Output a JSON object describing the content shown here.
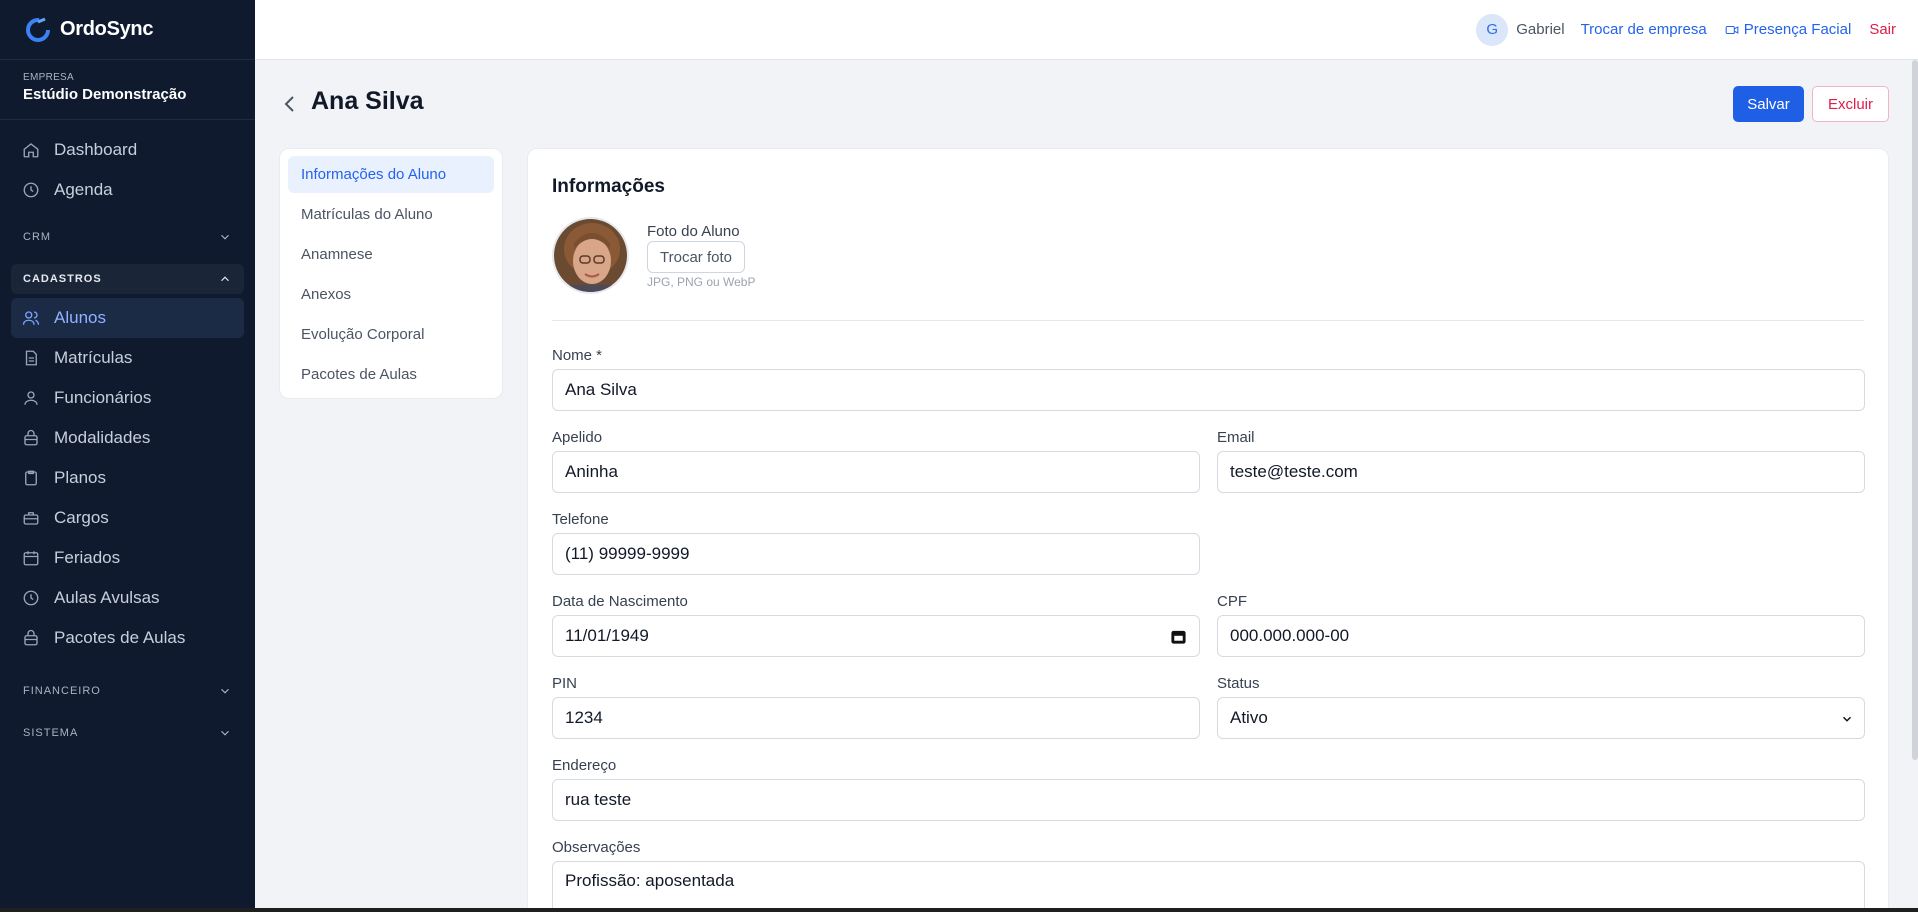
{
  "brand": {
    "name": "OrdoSync"
  },
  "company": {
    "label": "EMPRESA",
    "name": "Estúdio Demonstração"
  },
  "sidebar": {
    "top_items": [
      {
        "label": "Dashboard",
        "icon": "home-icon"
      },
      {
        "label": "Agenda",
        "icon": "clock-icon"
      }
    ],
    "sections": {
      "crm": "CRM",
      "cadastros": "CADASTROS",
      "financeiro": "FINANCEIRO",
      "sistema": "SISTEMA"
    },
    "cadastros_items": [
      {
        "label": "Alunos",
        "icon": "users-icon",
        "active": true
      },
      {
        "label": "Matrículas",
        "icon": "document-icon"
      },
      {
        "label": "Funcionários",
        "icon": "user-icon"
      },
      {
        "label": "Modalidades",
        "icon": "bag-icon"
      },
      {
        "label": "Planos",
        "icon": "clipboard-icon"
      },
      {
        "label": "Cargos",
        "icon": "briefcase-icon"
      },
      {
        "label": "Feriados",
        "icon": "calendar-icon"
      },
      {
        "label": "Aulas Avulsas",
        "icon": "clock-icon"
      },
      {
        "label": "Pacotes de Aulas",
        "icon": "bag-icon"
      }
    ]
  },
  "topbar": {
    "avatar_initial": "G",
    "user": "Gabriel",
    "switch_company": "Trocar de empresa",
    "face": "Presença Facial",
    "logout": "Sair"
  },
  "page": {
    "title": "Ana Silva",
    "save": "Salvar",
    "delete": "Excluir"
  },
  "subnav": [
    {
      "label": "Informações do Aluno",
      "active": true
    },
    {
      "label": "Matrículas do Aluno"
    },
    {
      "label": "Anamnese"
    },
    {
      "label": "Anexos"
    },
    {
      "label": "Evolução Corporal"
    },
    {
      "label": "Pacotes de Aulas"
    }
  ],
  "form": {
    "section_title": "Informações",
    "photo_label": "Foto do Aluno",
    "photo_button": "Trocar foto",
    "photo_hint": "JPG, PNG ou WebP",
    "nome": {
      "label": "Nome *",
      "value": "Ana Silva"
    },
    "apelido": {
      "label": "Apelido",
      "value": "Aninha"
    },
    "email": {
      "label": "Email",
      "value": "teste@teste.com"
    },
    "telefone": {
      "label": "Telefone",
      "value": "(11) 99999-9999"
    },
    "nascimento": {
      "label": "Data de Nascimento",
      "value": "11/01/1949"
    },
    "cpf": {
      "label": "CPF",
      "value": "000.000.000-00"
    },
    "pin": {
      "label": "PIN",
      "value": "1234"
    },
    "status": {
      "label": "Status",
      "value": "Ativo"
    },
    "endereco": {
      "label": "Endereço",
      "value": "rua teste"
    },
    "observacoes": {
      "label": "Observações",
      "value": "Profissão: aposentada"
    }
  },
  "colors": {
    "primary": "#1f5fe6",
    "danger": "#e11d48",
    "sidebar_bg": "#0f1a2e"
  }
}
